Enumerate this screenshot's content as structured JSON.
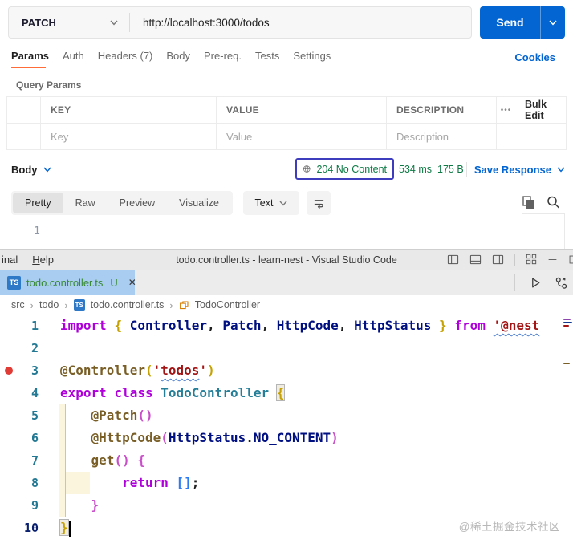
{
  "colors": {
    "accent_orange": "#ff6c37",
    "accent_blue": "#0265d2",
    "status_green": "#0e7a45",
    "breakpoint_red": "#e13b36"
  },
  "postman": {
    "method": "PATCH",
    "url": "http://localhost:3000/todos",
    "send_label": "Send",
    "tabs": [
      "Params",
      "Auth",
      "Headers (7)",
      "Body",
      "Pre-req.",
      "Tests",
      "Settings"
    ],
    "cookies_label": "Cookies",
    "query_params": {
      "title": "Query Params",
      "col_key": "KEY",
      "col_value": "VALUE",
      "col_description": "DESCRIPTION",
      "more": "•••",
      "bulk_edit": "Bulk Edit",
      "ph_key": "Key",
      "ph_value": "Value",
      "ph_description": "Description"
    },
    "response": {
      "body_label": "Body",
      "status": "204 No Content",
      "time": "534 ms",
      "size": "175 B",
      "save_label": "Save Response",
      "views": [
        "Pretty",
        "Raw",
        "Preview",
        "Visualize"
      ],
      "format": "Text",
      "line1": "1"
    }
  },
  "vscode": {
    "menus": [
      "inal",
      "Help"
    ],
    "window_title": "todo.controller.ts - learn-nest - Visual Studio Code",
    "tab": {
      "name": "todo.controller.ts",
      "badge": "U",
      "close": "✕",
      "icon_text": "TS"
    },
    "breadcrumbs": {
      "i0": "src",
      "i1": "todo",
      "i2": "todo.controller.ts",
      "i3": "TodoController",
      "sep": "›"
    },
    "watermark": "@稀土掘金技术社区",
    "code": {
      "lines": [
        {
          "no": "1",
          "tokens": [
            {
              "t": "import",
              "c": "kw"
            },
            {
              "t": " "
            },
            {
              "t": "{",
              "c": "b1"
            },
            {
              "t": " "
            },
            {
              "t": "Controller",
              "c": "id"
            },
            {
              "t": ", "
            },
            {
              "t": "Patch",
              "c": "id"
            },
            {
              "t": ", "
            },
            {
              "t": "HttpCode",
              "c": "id"
            },
            {
              "t": ", "
            },
            {
              "t": "HttpStatus",
              "c": "id"
            },
            {
              "t": " "
            },
            {
              "t": "}",
              "c": "b1"
            },
            {
              "t": " "
            },
            {
              "t": "from",
              "c": "kw"
            },
            {
              "t": " "
            },
            {
              "t": "'@nest",
              "c": "str sq"
            }
          ]
        },
        {
          "no": "2",
          "tokens": []
        },
        {
          "no": "3",
          "bp": true,
          "tokens": [
            {
              "t": "@Controller",
              "c": "fn"
            },
            {
              "t": "(",
              "c": "b1"
            },
            {
              "t": "'",
              "c": "str"
            },
            {
              "t": "todos",
              "c": "str sq"
            },
            {
              "t": "'",
              "c": "str"
            },
            {
              "t": ")",
              "c": "b1"
            }
          ]
        },
        {
          "no": "4",
          "tokens": [
            {
              "t": "export",
              "c": "kw"
            },
            {
              "t": " "
            },
            {
              "t": "class",
              "c": "kw"
            },
            {
              "t": " "
            },
            {
              "t": "TodoController",
              "c": "cls"
            },
            {
              "t": " "
            },
            {
              "t": "{",
              "c": "b1 match"
            }
          ]
        },
        {
          "no": "5",
          "tokens": [
            {
              "t": "    "
            },
            {
              "t": "@Patch",
              "c": "fn"
            },
            {
              "t": "()",
              "c": "b2"
            }
          ]
        },
        {
          "no": "6",
          "tokens": [
            {
              "t": "    "
            },
            {
              "t": "@HttpCode",
              "c": "fn"
            },
            {
              "t": "(",
              "c": "b2"
            },
            {
              "t": "HttpStatus",
              "c": "id"
            },
            {
              "t": "."
            },
            {
              "t": "NO_CONTENT",
              "c": "id"
            },
            {
              "t": ")",
              "c": "b2"
            }
          ]
        },
        {
          "no": "7",
          "tokens": [
            {
              "t": "    "
            },
            {
              "t": "get",
              "c": "fn"
            },
            {
              "t": "()",
              "c": "b2"
            },
            {
              "t": " "
            },
            {
              "t": "{",
              "c": "b2"
            }
          ]
        },
        {
          "no": "8",
          "tokens": [
            {
              "t": "        "
            },
            {
              "t": "return",
              "c": "kw"
            },
            {
              "t": " "
            },
            {
              "t": "[]",
              "c": "b3"
            },
            {
              "t": ";"
            }
          ]
        },
        {
          "no": "9",
          "tokens": [
            {
              "t": "    "
            },
            {
              "t": "}",
              "c": "b2"
            }
          ]
        },
        {
          "no": "10",
          "active": true,
          "cursor": true,
          "tokens": [
            {
              "t": "}",
              "c": "b1 match"
            }
          ]
        }
      ]
    }
  }
}
